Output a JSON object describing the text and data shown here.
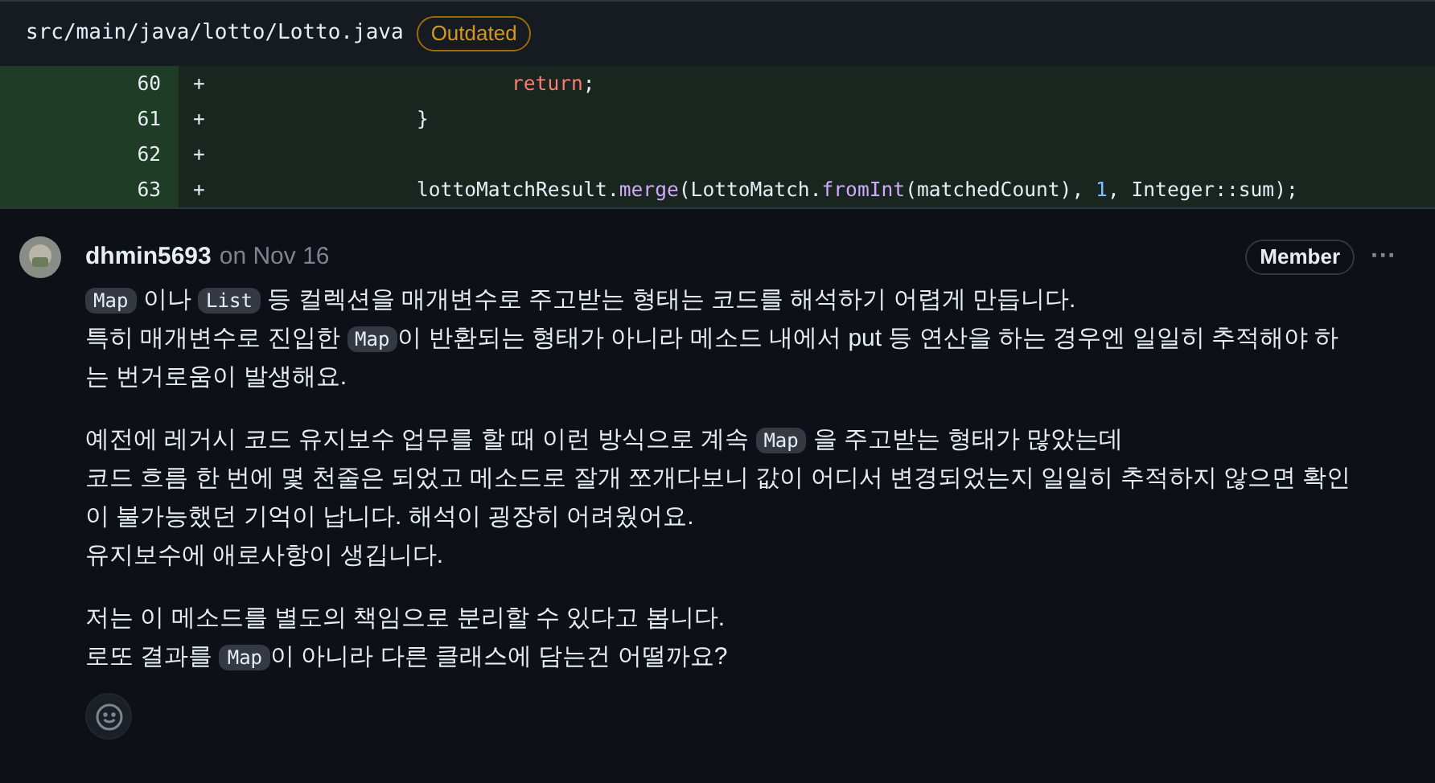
{
  "file_header": {
    "path": "src/main/java/lotto/Lotto.java",
    "badge": "Outdated"
  },
  "diff_lines": [
    {
      "number": "60",
      "sign": "+",
      "kind": "nested",
      "tokens": [
        {
          "kind": "keyword",
          "text": "return"
        },
        {
          "kind": "plain",
          "text": ";"
        }
      ]
    },
    {
      "number": "61",
      "sign": "+",
      "kind": "block",
      "tokens": [
        {
          "kind": "plain",
          "text": "}"
        }
      ]
    },
    {
      "number": "62",
      "sign": "+",
      "kind": "blank"
    },
    {
      "number": "63",
      "sign": "+",
      "kind": "block",
      "tokens": [
        {
          "kind": "plain",
          "text": "lottoMatchResult."
        },
        {
          "kind": "method",
          "text": "merge"
        },
        {
          "kind": "plain",
          "text": "(LottoMatch."
        },
        {
          "kind": "method",
          "text": "fromInt"
        },
        {
          "kind": "plain",
          "text": "(matchedCount), "
        },
        {
          "kind": "number",
          "text": "1"
        },
        {
          "kind": "plain",
          "text": ", Integer::sum);"
        }
      ]
    }
  ],
  "comment": {
    "author": "dhmin5693",
    "date": "on Nov 16",
    "role": "Member",
    "more": "···",
    "paragraphs": [
      [
        [
          {
            "kind": "code",
            "text": "Map"
          },
          {
            "kind": "text",
            "text": " 이나 "
          },
          {
            "kind": "code",
            "text": "List"
          },
          {
            "kind": "text",
            "text": " 등 컬렉션을 매개변수로 주고받는 형태는 코드를 해석하기 어렵게 만듭니다."
          }
        ],
        [
          {
            "kind": "text",
            "text": "특히 매개변수로 진입한 "
          },
          {
            "kind": "code",
            "text": "Map"
          },
          {
            "kind": "text",
            "text": "이 반환되는 형태가 아니라 메소드 내에서 put 등 연산을 하는 경우엔 일일히 추적해야 하"
          }
        ],
        [
          {
            "kind": "text",
            "text": "는 번거로움이 발생해요."
          }
        ]
      ],
      [
        [
          {
            "kind": "text",
            "text": "예전에 레거시 코드 유지보수 업무를 할 때 이런 방식으로 계속 "
          },
          {
            "kind": "code",
            "text": "Map"
          },
          {
            "kind": "text",
            "text": " 을 주고받는 형태가 많았는데"
          }
        ],
        [
          {
            "kind": "text",
            "text": "코드 흐름 한 번에 몇 천줄은 되었고 메소드로 잘개 쪼개다보니 값이 어디서 변경되었는지 일일히 추적하지 않으면 확인"
          }
        ],
        [
          {
            "kind": "text",
            "text": "이 불가능했던 기억이 납니다. 해석이 굉장히 어려웠어요."
          }
        ],
        [
          {
            "kind": "text",
            "text": "유지보수에 애로사항이 생깁니다."
          }
        ]
      ],
      [
        [
          {
            "kind": "text",
            "text": "저는 이 메소드를 별도의 책임으로 분리할 수 있다고 봅니다."
          }
        ],
        [
          {
            "kind": "text",
            "text": "로또 결과를 "
          },
          {
            "kind": "code",
            "text": "Map"
          },
          {
            "kind": "text",
            "text": "이 아니라 다른 클래스에 담는건 어떨까요?"
          }
        ]
      ]
    ]
  }
}
